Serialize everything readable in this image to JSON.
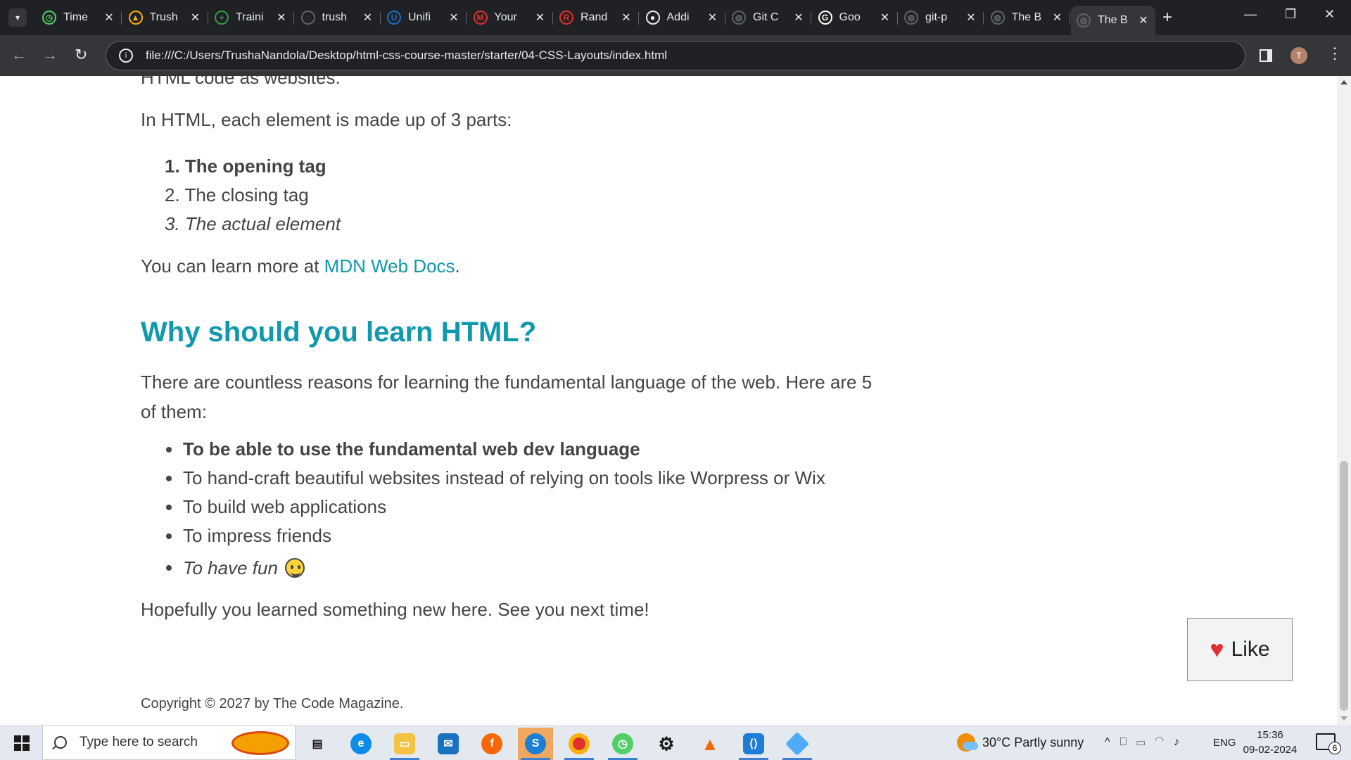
{
  "browser": {
    "tabs": [
      {
        "title": "Time",
        "icon": "timer-icon",
        "color": "#51cf66"
      },
      {
        "title": "Trush",
        "icon": "google-drive-icon",
        "color": "#fab005"
      },
      {
        "title": "Traini",
        "icon": "google-sheets-icon",
        "color": "#2f9e44"
      },
      {
        "title": "trush",
        "icon": "loading-icon",
        "color": "#5f6368"
      },
      {
        "title": "Unifi",
        "icon": "shield-icon",
        "color": "#1971c2"
      },
      {
        "title": "Your",
        "icon": "gmail-icon",
        "color": "#e03131"
      },
      {
        "title": "Rand",
        "icon": "random-r-icon",
        "color": "#e03131"
      },
      {
        "title": "Addi",
        "icon": "github-icon",
        "color": "#e8eaed"
      },
      {
        "title": "Git C",
        "icon": "globe-icon",
        "color": "#5f6368"
      },
      {
        "title": "Goo",
        "icon": "google-icon",
        "color": "#ffffff"
      },
      {
        "title": "git-p",
        "icon": "globe-icon",
        "color": "#5f6368"
      },
      {
        "title": "The B",
        "icon": "globe-icon",
        "color": "#5f6368"
      },
      {
        "title": "The B",
        "icon": "globe-icon",
        "color": "#5f6368",
        "active": true
      }
    ],
    "url": "file:///C:/Users/TrushaNandola/Desktop/html-css-course-master/starter/04-CSS-Layouts/index.html",
    "profile_initial": "T"
  },
  "page": {
    "top_text": "HTML code as websites.",
    "intro": "In HTML, each element is made up of 3 parts:",
    "parts": [
      "The opening tag",
      "The closing tag",
      "The actual element"
    ],
    "learn_prefix": "You can learn more at ",
    "learn_link": "MDN Web Docs",
    "learn_suffix": ".",
    "heading": "Why should you learn HTML?",
    "reasons_intro": "There are countless reasons for learning the fundamental language of the web. Here are 5 of them:",
    "reasons": [
      "To be able to use the fundamental web dev language",
      "To hand-craft beautiful websites instead of relying on tools like Worpress or Wix",
      "To build web applications",
      "To impress friends",
      "To have fun"
    ],
    "closing": "Hopefully you learned something new here. See you next time!",
    "footer": "Copyright © 2027 by The Code Magazine.",
    "like_label": "Like",
    "accent_color": "#1098ad"
  },
  "taskbar": {
    "search_placeholder": "Type here to search",
    "weather": "30°C  Partly sunny",
    "language": "ENG",
    "time": "15:36",
    "date": "09-02-2024",
    "notifications": "6"
  }
}
